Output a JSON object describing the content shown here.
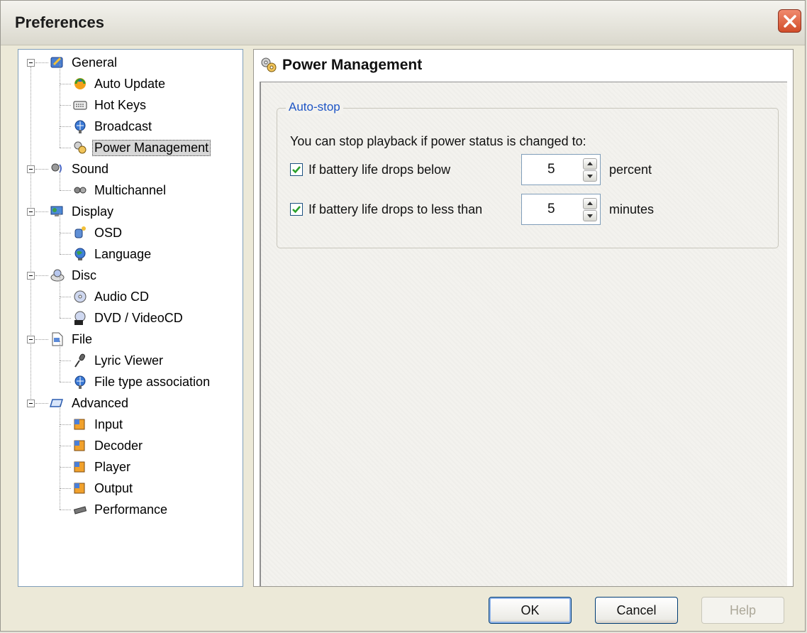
{
  "window": {
    "title": "Preferences"
  },
  "tree": {
    "items": [
      {
        "label": "General",
        "level": 0,
        "icon": "general-icon"
      },
      {
        "label": "Auto Update",
        "level": 1,
        "icon": "auto-update-icon"
      },
      {
        "label": "Hot Keys",
        "level": 1,
        "icon": "keyboard-icon"
      },
      {
        "label": "Broadcast",
        "level": 1,
        "icon": "broadcast-icon"
      },
      {
        "label": "Power Management",
        "level": 1,
        "icon": "power-management-icon",
        "selected": true
      },
      {
        "label": "Sound",
        "level": 0,
        "icon": "sound-icon"
      },
      {
        "label": "Multichannel",
        "level": 1,
        "icon": "multichannel-icon"
      },
      {
        "label": "Display",
        "level": 0,
        "icon": "display-icon"
      },
      {
        "label": "OSD",
        "level": 1,
        "icon": "osd-icon"
      },
      {
        "label": "Language",
        "level": 1,
        "icon": "globe-icon"
      },
      {
        "label": "Disc",
        "level": 0,
        "icon": "disc-icon"
      },
      {
        "label": "Audio CD",
        "level": 1,
        "icon": "audio-cd-icon"
      },
      {
        "label": "DVD / VideoCD",
        "level": 1,
        "icon": "dvd-icon"
      },
      {
        "label": "File",
        "level": 0,
        "icon": "file-icon"
      },
      {
        "label": "Lyric Viewer",
        "level": 1,
        "icon": "microphone-icon"
      },
      {
        "label": "File type association",
        "level": 1,
        "icon": "file-association-icon"
      },
      {
        "label": "Advanced",
        "level": 0,
        "icon": "advanced-icon"
      },
      {
        "label": "Input",
        "level": 1,
        "icon": "input-cube-icon"
      },
      {
        "label": "Decoder",
        "level": 1,
        "icon": "decoder-cube-icon"
      },
      {
        "label": "Player",
        "level": 1,
        "icon": "player-cube-icon"
      },
      {
        "label": "Output",
        "level": 1,
        "icon": "output-cube-icon"
      },
      {
        "label": "Performance",
        "level": 1,
        "icon": "chip-icon"
      }
    ]
  },
  "page": {
    "title": "Power Management",
    "icon": "power-management-icon",
    "group": {
      "legend": "Auto-stop",
      "description": "You can stop playback if power status is changed to:",
      "options": [
        {
          "label": "If battery life drops below",
          "checked": true,
          "value": "5",
          "unit": "percent"
        },
        {
          "label": "If battery life drops to less than",
          "checked": true,
          "value": "5",
          "unit": "minutes"
        }
      ]
    }
  },
  "buttons": {
    "ok": "OK",
    "cancel": "Cancel",
    "help": "Help"
  },
  "colors": {
    "legend": "#1f56c6",
    "selection": "#d7d7d7",
    "check": "#2aa02a"
  }
}
